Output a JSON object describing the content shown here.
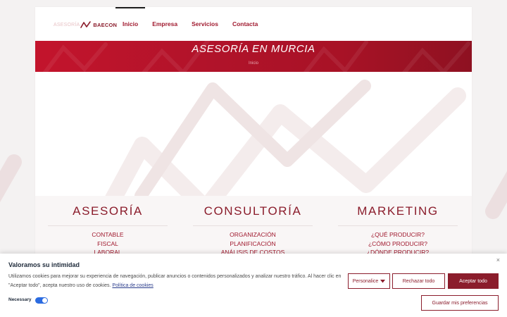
{
  "logo": {
    "prefix": "ASESORÍA",
    "brand": "BAECON"
  },
  "nav": [
    {
      "label": "Inicio",
      "active": true
    },
    {
      "label": "Empresa",
      "active": false
    },
    {
      "label": "Servicios",
      "active": false
    },
    {
      "label": "Contacta",
      "active": false
    }
  ],
  "hero": {
    "title": "ASESORÍA EN MURCIA",
    "breadcrumb": "Inicio"
  },
  "services": [
    {
      "title": "ASESORÍA",
      "items": [
        "CONTABLE",
        "FISCAL",
        "LABORAL"
      ]
    },
    {
      "title": "CONSULTORÍA",
      "items": [
        "ORGANIZACIÓN",
        "PLANIFICACIÓN",
        "ANÁLISIS DE COSTOS"
      ]
    },
    {
      "title": "MARKETING",
      "items": [
        "¿QUÉ PRODUCIR?",
        "¿CÓMO PRODUCIR?",
        "¿DÓNDE PRODUCIR?"
      ]
    }
  ],
  "cookie": {
    "title": "Valoramos su intimidad",
    "text": "Utilizamos cookies para mejorar su experiencia de navegación, publicar anuncios o contenidos personalizados y analizar nuestro tráfico. Al hacer clic en \"Aceptar todo\", acepta nuestro uso de cookies.",
    "policy_link": "Política de cookies",
    "close_icon": "×",
    "customize_label": "Personalice",
    "reject_label": "Rechazar todo",
    "accept_label": "Aceptar todo",
    "save_label": "Guardar mis preferencias",
    "necessary_label": "Necessary",
    "necessary_enabled": true
  },
  "colors": {
    "brand": "#8b1d2c",
    "hero": "#b1132a",
    "toggle": "#2b6be0"
  },
  "icons": {
    "logo": "zigzag-logo-icon",
    "dropdown": "caret-down-icon",
    "close": "close-icon"
  }
}
